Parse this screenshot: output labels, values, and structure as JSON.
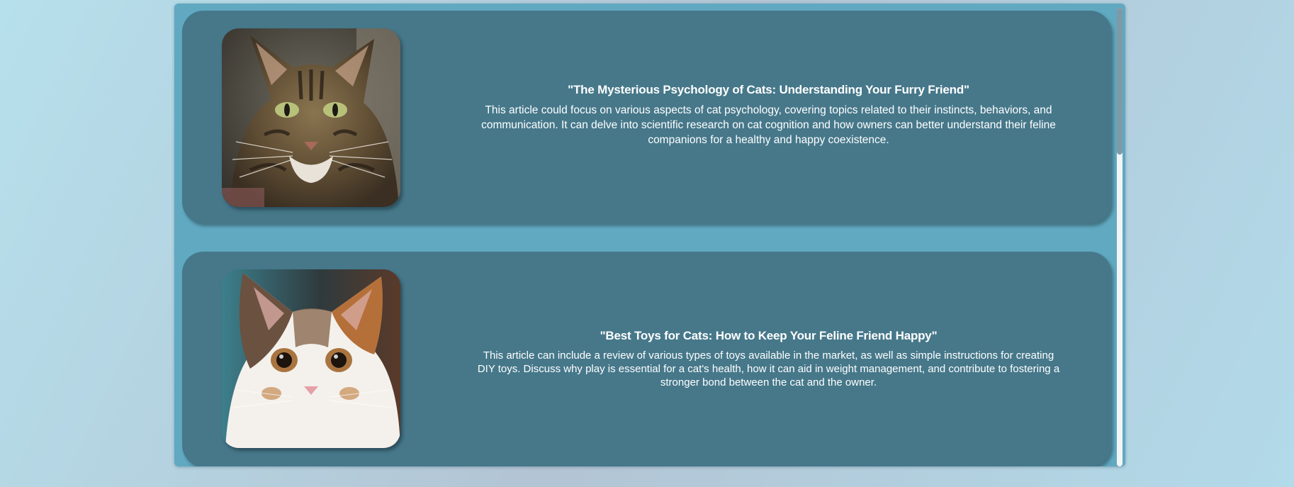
{
  "articles": [
    {
      "title": "\"The Mysterious Psychology of Cats: Understanding Your Furry Friend\"",
      "description": "This article could focus on various aspects of cat psychology, covering topics related to their instincts, behaviors, and communication. It can delve into scientific research on cat cognition and how owners can better understand their feline companions for a healthy and happy coexistence.",
      "image": "tabby-cat-photo"
    },
    {
      "title": "\"Best Toys for Cats: How to Keep Your Feline Friend Happy\"",
      "description": "This article can include a review of various types of toys available in the market, as well as simple instructions for creating DIY toys. Discuss why play is essential for a cat's health, how it can aid in weight management, and contribute to fostering a stronger bond between the cat and the owner.",
      "image": "calico-kitten-photo"
    }
  ],
  "colors": {
    "panel": "#60a9c1",
    "card": "#46788a",
    "text": "#ffffff",
    "scrollbar_thumb": "#7f99a6"
  }
}
